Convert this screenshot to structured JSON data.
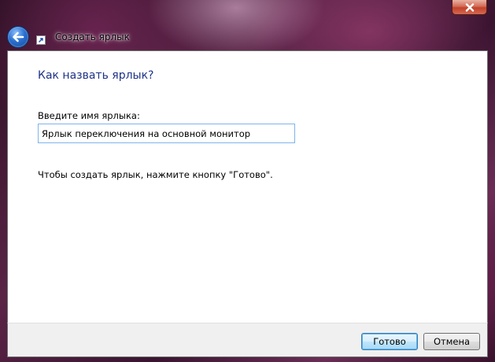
{
  "window": {
    "title": "Создать ярлык"
  },
  "content": {
    "heading": "Как назвать ярлык?",
    "name_label": "Введите имя ярлыка:",
    "name_value": "Ярлык переключения на основной монитор",
    "hint": "Чтобы создать ярлык, нажмите кнопку \"Готово\"."
  },
  "buttons": {
    "finish": "Готово",
    "cancel": "Отмена"
  },
  "icons": {
    "close": "close-icon",
    "back": "back-arrow-icon",
    "shortcut": "shortcut-icon"
  },
  "colors": {
    "heading": "#1e3287",
    "input_border": "#7eb4ea",
    "close_button": "#c2412a",
    "back_button": "#2a6fd0"
  }
}
